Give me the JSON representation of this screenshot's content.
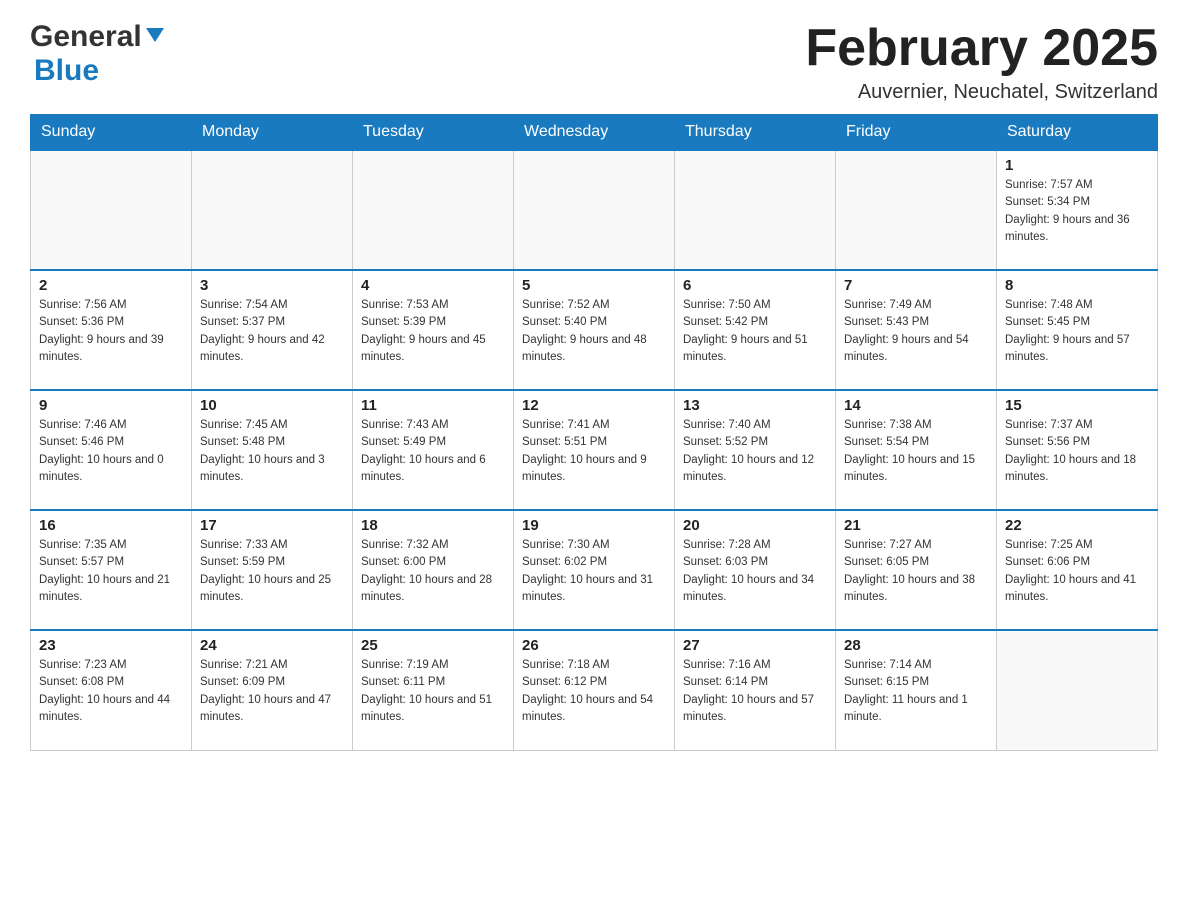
{
  "header": {
    "logo": {
      "general": "General",
      "blue": "Blue"
    },
    "title": "February 2025",
    "location": "Auvernier, Neuchatel, Switzerland"
  },
  "days_of_week": [
    "Sunday",
    "Monday",
    "Tuesday",
    "Wednesday",
    "Thursday",
    "Friday",
    "Saturday"
  ],
  "weeks": [
    [
      {
        "day": "",
        "info": ""
      },
      {
        "day": "",
        "info": ""
      },
      {
        "day": "",
        "info": ""
      },
      {
        "day": "",
        "info": ""
      },
      {
        "day": "",
        "info": ""
      },
      {
        "day": "",
        "info": ""
      },
      {
        "day": "1",
        "info": "Sunrise: 7:57 AM\nSunset: 5:34 PM\nDaylight: 9 hours and 36 minutes."
      }
    ],
    [
      {
        "day": "2",
        "info": "Sunrise: 7:56 AM\nSunset: 5:36 PM\nDaylight: 9 hours and 39 minutes."
      },
      {
        "day": "3",
        "info": "Sunrise: 7:54 AM\nSunset: 5:37 PM\nDaylight: 9 hours and 42 minutes."
      },
      {
        "day": "4",
        "info": "Sunrise: 7:53 AM\nSunset: 5:39 PM\nDaylight: 9 hours and 45 minutes."
      },
      {
        "day": "5",
        "info": "Sunrise: 7:52 AM\nSunset: 5:40 PM\nDaylight: 9 hours and 48 minutes."
      },
      {
        "day": "6",
        "info": "Sunrise: 7:50 AM\nSunset: 5:42 PM\nDaylight: 9 hours and 51 minutes."
      },
      {
        "day": "7",
        "info": "Sunrise: 7:49 AM\nSunset: 5:43 PM\nDaylight: 9 hours and 54 minutes."
      },
      {
        "day": "8",
        "info": "Sunrise: 7:48 AM\nSunset: 5:45 PM\nDaylight: 9 hours and 57 minutes."
      }
    ],
    [
      {
        "day": "9",
        "info": "Sunrise: 7:46 AM\nSunset: 5:46 PM\nDaylight: 10 hours and 0 minutes."
      },
      {
        "day": "10",
        "info": "Sunrise: 7:45 AM\nSunset: 5:48 PM\nDaylight: 10 hours and 3 minutes."
      },
      {
        "day": "11",
        "info": "Sunrise: 7:43 AM\nSunset: 5:49 PM\nDaylight: 10 hours and 6 minutes."
      },
      {
        "day": "12",
        "info": "Sunrise: 7:41 AM\nSunset: 5:51 PM\nDaylight: 10 hours and 9 minutes."
      },
      {
        "day": "13",
        "info": "Sunrise: 7:40 AM\nSunset: 5:52 PM\nDaylight: 10 hours and 12 minutes."
      },
      {
        "day": "14",
        "info": "Sunrise: 7:38 AM\nSunset: 5:54 PM\nDaylight: 10 hours and 15 minutes."
      },
      {
        "day": "15",
        "info": "Sunrise: 7:37 AM\nSunset: 5:56 PM\nDaylight: 10 hours and 18 minutes."
      }
    ],
    [
      {
        "day": "16",
        "info": "Sunrise: 7:35 AM\nSunset: 5:57 PM\nDaylight: 10 hours and 21 minutes."
      },
      {
        "day": "17",
        "info": "Sunrise: 7:33 AM\nSunset: 5:59 PM\nDaylight: 10 hours and 25 minutes."
      },
      {
        "day": "18",
        "info": "Sunrise: 7:32 AM\nSunset: 6:00 PM\nDaylight: 10 hours and 28 minutes."
      },
      {
        "day": "19",
        "info": "Sunrise: 7:30 AM\nSunset: 6:02 PM\nDaylight: 10 hours and 31 minutes."
      },
      {
        "day": "20",
        "info": "Sunrise: 7:28 AM\nSunset: 6:03 PM\nDaylight: 10 hours and 34 minutes."
      },
      {
        "day": "21",
        "info": "Sunrise: 7:27 AM\nSunset: 6:05 PM\nDaylight: 10 hours and 38 minutes."
      },
      {
        "day": "22",
        "info": "Sunrise: 7:25 AM\nSunset: 6:06 PM\nDaylight: 10 hours and 41 minutes."
      }
    ],
    [
      {
        "day": "23",
        "info": "Sunrise: 7:23 AM\nSunset: 6:08 PM\nDaylight: 10 hours and 44 minutes."
      },
      {
        "day": "24",
        "info": "Sunrise: 7:21 AM\nSunset: 6:09 PM\nDaylight: 10 hours and 47 minutes."
      },
      {
        "day": "25",
        "info": "Sunrise: 7:19 AM\nSunset: 6:11 PM\nDaylight: 10 hours and 51 minutes."
      },
      {
        "day": "26",
        "info": "Sunrise: 7:18 AM\nSunset: 6:12 PM\nDaylight: 10 hours and 54 minutes."
      },
      {
        "day": "27",
        "info": "Sunrise: 7:16 AM\nSunset: 6:14 PM\nDaylight: 10 hours and 57 minutes."
      },
      {
        "day": "28",
        "info": "Sunrise: 7:14 AM\nSunset: 6:15 PM\nDaylight: 11 hours and 1 minute."
      },
      {
        "day": "",
        "info": ""
      }
    ]
  ]
}
